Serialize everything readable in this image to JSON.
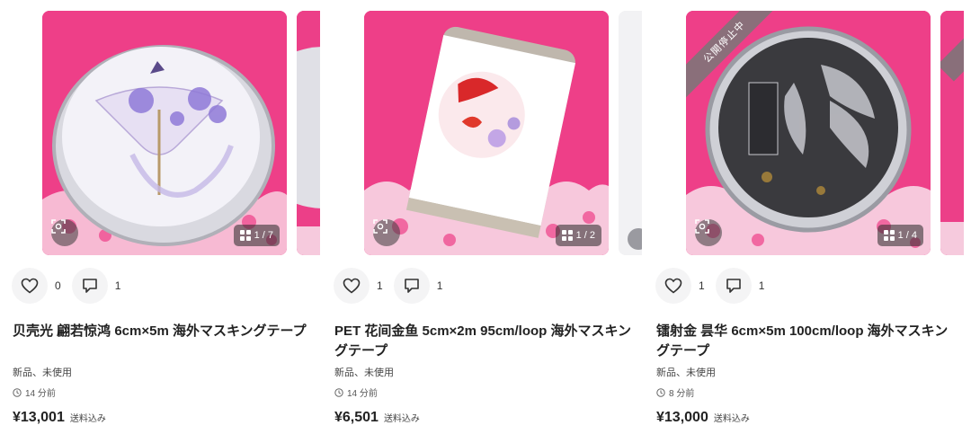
{
  "listings": [
    {
      "title": "贝壳光 翩若惊鸿 6cm×5m 海外マスキングテープ",
      "likes": "0",
      "comments": "1",
      "condition": "新品、未使用",
      "posted": "14 分前",
      "price": "¥13,001",
      "shipping": "送料込み",
      "image_count": "1 / 7",
      "status_ribbon": "",
      "image_icon": "fairy-umbrella-tape-roll-icon"
    },
    {
      "title": "PET 花间金鱼 5cm×2m 95cm/loop 海外マスキングテープ",
      "likes": "1",
      "comments": "1",
      "condition": "新品、未使用",
      "posted": "14 分前",
      "price": "¥6,501",
      "shipping": "送料込み",
      "image_count": "1 / 2",
      "status_ribbon": "",
      "image_icon": "goldfish-tape-roll-icon"
    },
    {
      "title": "镭射金 昙华 6cm×5m 100cm/loop 海外マスキングテープ",
      "likes": "1",
      "comments": "1",
      "condition": "新品、未使用",
      "posted": "8 分前",
      "price": "¥13,000",
      "shipping": "送料込み",
      "image_count": "1 / 4",
      "status_ribbon": "公開停止中",
      "image_icon": "silver-flower-tape-roll-icon"
    }
  ],
  "next_card_peek": {
    "status_ribbon": "公"
  },
  "colors": {
    "photo_background": "#ee3f88",
    "ribbon": "#787878",
    "action_button": "#f4f4f5"
  }
}
